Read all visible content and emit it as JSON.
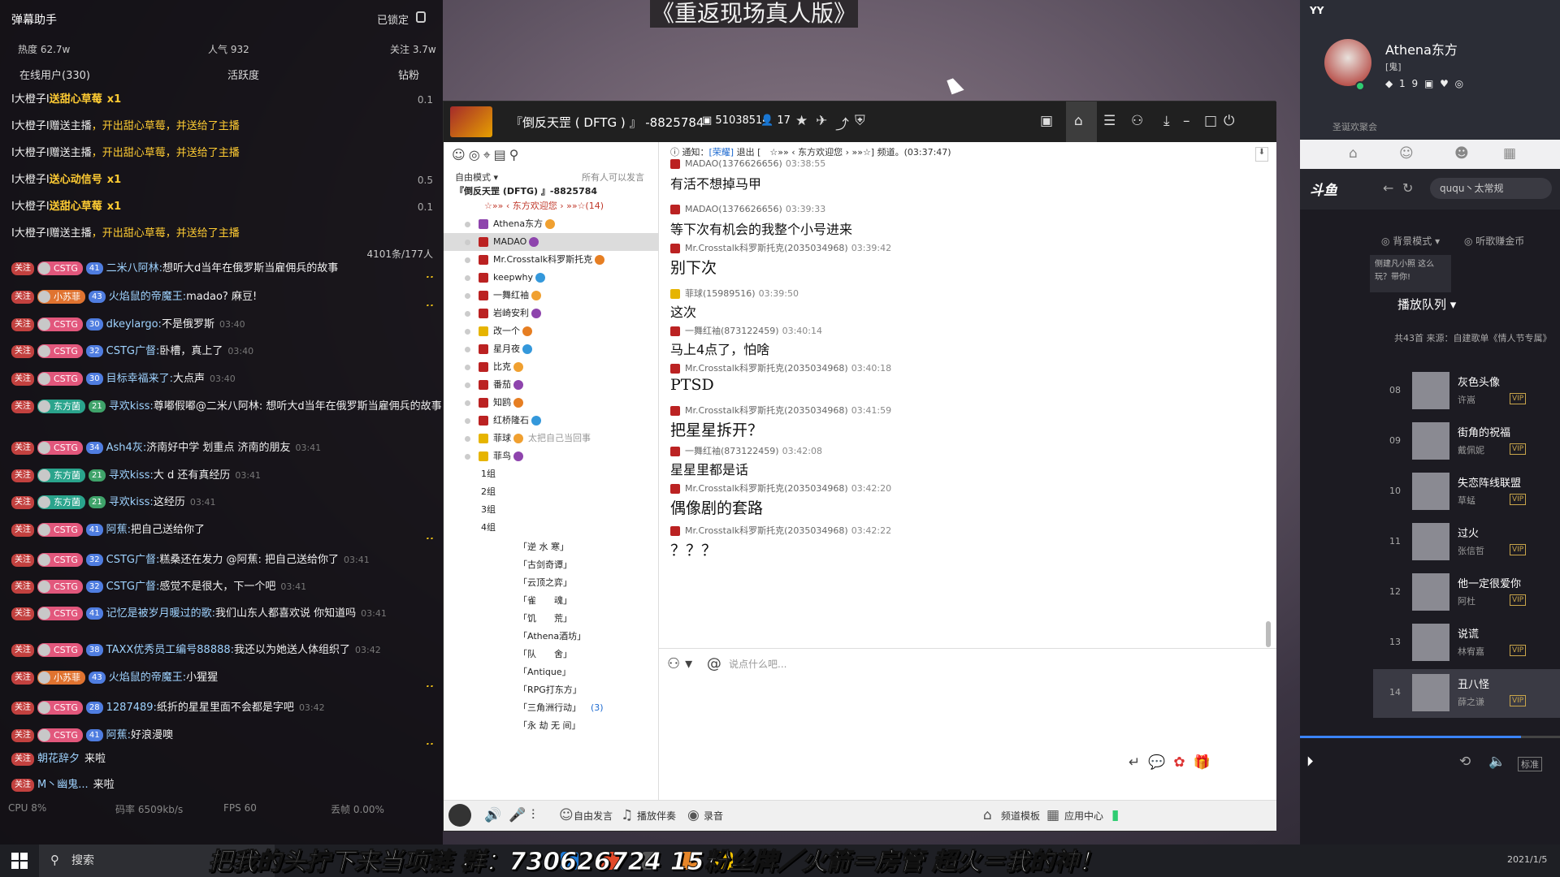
{
  "stream_title": "《重返现场真人版》",
  "banner_text": "把我的头拧下来当项链  群：730626724  15粉丝牌／火箭＝房管  超火＝我的神！",
  "danmu": {
    "title": "弹幕助手",
    "lock": "已锁定",
    "heat": "热度 62.7w",
    "popularity": "人气 932",
    "follow": "关注 3.7w",
    "tabs": [
      "在线用户(330)",
      "活跃度",
      "钻粉"
    ],
    "gifts": [
      {
        "user": "I大橙子I",
        "action": "送",
        "item": "甜心草莓",
        "count": "x1",
        "value": "0.1"
      },
      {
        "user": "I大橙子I",
        "action": "赠送主播",
        "item": "，开出甜心草莓，并送给了主播",
        "count": "",
        "value": ""
      },
      {
        "user": "I大橙子I",
        "action": "赠送主播",
        "item": "，开出甜心草莓，并送给了主播",
        "count": "",
        "value": ""
      },
      {
        "user": "I大橙子I",
        "action": "送",
        "item": "心动信号",
        "count": "x1",
        "value": "0.5"
      },
      {
        "user": "I大橙子I",
        "action": "送",
        "item": "甜心草莓",
        "count": "x1",
        "value": "0.1"
      },
      {
        "user": "I大橙子I",
        "action": "赠送主播",
        "item": "，开出甜心草莓，并送给了主播",
        "count": "",
        "value": ""
      }
    ],
    "counter": "4101条/177人",
    "messages": [
      {
        "fan": "CSTG",
        "lv": "41",
        "name": "二米八阿林:",
        "text": "想听大d当年在俄罗斯当雇佣兵的故事",
        "time": "",
        "h": true
      },
      {
        "fan": "小苏菲",
        "lv": "43",
        "name": "火焰鼠的帝魔王:",
        "text": "madao? 麻豆!",
        "time": "",
        "h": true
      },
      {
        "fan": "CSTG",
        "lv": "30",
        "name": "dkeylargo:",
        "text": "不是俄罗斯",
        "time": "03:40",
        "h": false
      },
      {
        "fan": "CSTG",
        "lv": "32",
        "name": "CSTG广督:",
        "text": "卧槽，真上了",
        "time": "03:40",
        "h": false
      },
      {
        "fan": "CSTG",
        "lv": "30",
        "name": "目标幸福来了:",
        "text": "大点声",
        "time": "03:40",
        "h": false
      },
      {
        "fan": "东方菌",
        "lv": "21",
        "name": "寻欢kiss:",
        "text": "尊嘟假嘟@二米八阿林: 想听大d当年在俄罗斯当雇佣兵的故事",
        "time": "",
        "h": false
      },
      {
        "fan": "CSTG",
        "lv": "34",
        "name": "Ash4灰:",
        "text": "济南好中学 划重点 济南的朋友",
        "time": "03:41",
        "h": false
      },
      {
        "fan": "东方菌",
        "lv": "21",
        "name": "寻欢kiss:",
        "text": "大 d 还有真经历",
        "time": "03:41",
        "h": false
      },
      {
        "fan": "东方菌",
        "lv": "21",
        "name": "寻欢kiss:",
        "text": "这经历",
        "time": "03:41",
        "h": false
      },
      {
        "fan": "CSTG",
        "lv": "41",
        "name": "阿蕉:",
        "text": "把自己送给你了",
        "time": "",
        "h": true
      },
      {
        "fan": "CSTG",
        "lv": "32",
        "name": "CSTG广督:",
        "text": "糕桑还在发力 @阿蕉: 把自己送给你了",
        "time": "03:41",
        "h": false
      },
      {
        "fan": "CSTG",
        "lv": "32",
        "name": "CSTG广督:",
        "text": "感觉不是很大，下一个吧",
        "time": "03:41",
        "h": false
      },
      {
        "fan": "CSTG",
        "lv": "41",
        "name": "记忆是被岁月暖过的歌:",
        "text": "我们山东人都喜欢说 你知道吗",
        "time": "03:41",
        "h": false
      },
      {
        "fan": "CSTG",
        "lv": "38",
        "name": "TAXX优秀员工编号88888:",
        "text": "我还以为她送人体组织了",
        "time": "03:42",
        "h": false
      },
      {
        "fan": "小苏菲",
        "lv": "43",
        "name": "火焰鼠的帝魔王:",
        "text": "小猩猩",
        "time": "",
        "h": true
      },
      {
        "fan": "CSTG",
        "lv": "28",
        "name": "1287489:",
        "text": "纸折的星星里面不会都是字吧",
        "time": "03:42",
        "h": false
      },
      {
        "fan": "CSTG",
        "lv": "41",
        "name": "阿蕉:",
        "text": "好浪漫噢",
        "time": "",
        "h": true
      }
    ],
    "enters": [
      {
        "name": "朝花辞夕",
        "text": "来啦"
      },
      {
        "name": "M丶幽鬼...",
        "text": "来啦"
      }
    ],
    "footer": {
      "cpu": "CPU 8%",
      "rate": "码率 6509kb/s",
      "fps": "FPS 60",
      "drop": "丢帧 0.00%"
    },
    "off_label": "关注",
    "h_label": "H"
  },
  "yy": {
    "channel": "『倒反天罡 ( DFTG ) 』 -8825784",
    "id": "51038514",
    "users": "17",
    "left": {
      "mode": "自由模式",
      "all_speak": "所有人可以发言",
      "root": "『倒反天罡 (DFTG) 』-8825784",
      "welcome": "☆»» ‹ 东方欢迎您 › »»☆(14)",
      "members": [
        {
          "name": "Athena东方",
          "icon": "p",
          "sel": false
        },
        {
          "name": "MADAO",
          "icon": "r",
          "sel": true
        },
        {
          "name": "Mr.Crosstalk科罗斯托克",
          "icon": "r",
          "sel": false
        },
        {
          "name": "keepwhy",
          "icon": "r",
          "sel": false
        },
        {
          "name": "一舞红袖",
          "icon": "r",
          "sel": false
        },
        {
          "name": "岩崎安利",
          "icon": "r",
          "sel": false
        },
        {
          "name": "改一个",
          "icon": "y",
          "sel": false
        },
        {
          "name": "星月夜",
          "icon": "r",
          "sel": false
        },
        {
          "name": "比克",
          "icon": "r",
          "sel": false
        },
        {
          "name": "番茄",
          "icon": "r",
          "sel": false
        },
        {
          "name": "知鸥",
          "icon": "r",
          "sel": false
        },
        {
          "name": "红桥隆石",
          "icon": "r",
          "sel": false
        },
        {
          "name": "菲球",
          "icon": "y",
          "sel": false,
          "note": "太把自己当回事"
        },
        {
          "name": "菲鸟",
          "icon": "y",
          "sel": false
        }
      ],
      "groups": [
        "1组",
        "2组",
        "3组",
        "4组"
      ],
      "subchannels": [
        "「逆 水 寒」",
        "「古剑奇谭」",
        "「云顶之弈」",
        "「雀　　魂」",
        "「饥　　荒」",
        "「Athena酒坊」",
        "「队　　舍」",
        "「Antique」",
        "「RPG打东方」",
        "「三角洲行动」",
        "「永 劫 无 间」"
      ],
      "sub_extra": "(3)"
    },
    "notice": {
      "label": "通知：",
      "tag": "[荣耀]",
      "text": "退出 [　☆»» ‹ 东方欢迎您 › »»☆] 频道。(03:37:47)"
    },
    "messages": [
      {
        "user": "MADAO(1376626656)",
        "time": "03:38:55",
        "text": "有活不想掉马甲",
        "size": "s",
        "ic": "r"
      },
      {
        "user": "MADAO(1376626656)",
        "time": "03:39:33",
        "text": "等下次有机会的我整个小号进来",
        "size": "s",
        "ic": "r"
      },
      {
        "user": "Mr.Crosstalk科罗斯托克(2035034968)",
        "time": "03:39:42",
        "text": "别下次",
        "size": "l",
        "ic": "r"
      },
      {
        "user": "菲球(15989516)",
        "time": "03:39:50",
        "text": "这次",
        "size": "s",
        "ic": "y"
      },
      {
        "user": "一舞红袖(873122459)",
        "time": "03:40:14",
        "text": "马上4点了，怕啥",
        "size": "s",
        "ic": "r"
      },
      {
        "user": "Mr.Crosstalk科罗斯托克(2035034968)",
        "time": "03:40:18",
        "text": "PTSD",
        "size": "l",
        "ic": "r"
      },
      {
        "user": "Mr.Crosstalk科罗斯托克(2035034968)",
        "time": "03:41:59",
        "text": "把星星拆开？",
        "size": "l",
        "ic": "r"
      },
      {
        "user": "一舞红袖(873122459)",
        "time": "03:42:08",
        "text": "星星里都是话",
        "size": "s",
        "ic": "r"
      },
      {
        "user": "Mr.Crosstalk科罗斯托克(2035034968)",
        "time": "03:42:20",
        "text": "偶像剧的套路",
        "size": "l",
        "ic": "r"
      },
      {
        "user": "Mr.Crosstalk科罗斯托克(2035034968)",
        "time": "03:42:22",
        "text": "？？？",
        "size": "l",
        "ic": "r"
      }
    ],
    "input_placeholder": "说点什么吧...",
    "bottom": {
      "free": "自由发言",
      "play": "播放伴奏",
      "record": "录音",
      "template": "频道模板",
      "apps": "应用中心"
    }
  },
  "music": {
    "app": "YY",
    "name": "Athena东方",
    "sub": "[鬼]",
    "badges": "1 9",
    "hint": "圣诞欢聚会",
    "brand": "斗鱼",
    "search": "ququ丶太常规",
    "opt1": "背景模式",
    "opt2": "听歌赚金币",
    "toast": "侧建凡小照 这么玩？带你!",
    "queue": "播放队列",
    "count": "共43首  来源：自建歌单《情人节专属》",
    "songs": [
      {
        "n": "08",
        "title": "灰色头像",
        "artist": "许嵩"
      },
      {
        "n": "09",
        "title": "街角的祝福",
        "artist": "戴佩妮"
      },
      {
        "n": "10",
        "title": "失恋阵线联盟",
        "artist": "草蜢"
      },
      {
        "n": "11",
        "title": "过火",
        "artist": "张信哲"
      },
      {
        "n": "12",
        "title": "他一定很爱你",
        "artist": "阿杜"
      },
      {
        "n": "13",
        "title": "说谎",
        "artist": "林宥嘉"
      },
      {
        "n": "14",
        "title": "丑八怪",
        "artist": "薛之谦"
      }
    ],
    "vip": "VIP",
    "standard": "标准",
    "progress": 0.85
  },
  "taskbar": {
    "search": "搜索",
    "clock": "2021/1/5"
  }
}
